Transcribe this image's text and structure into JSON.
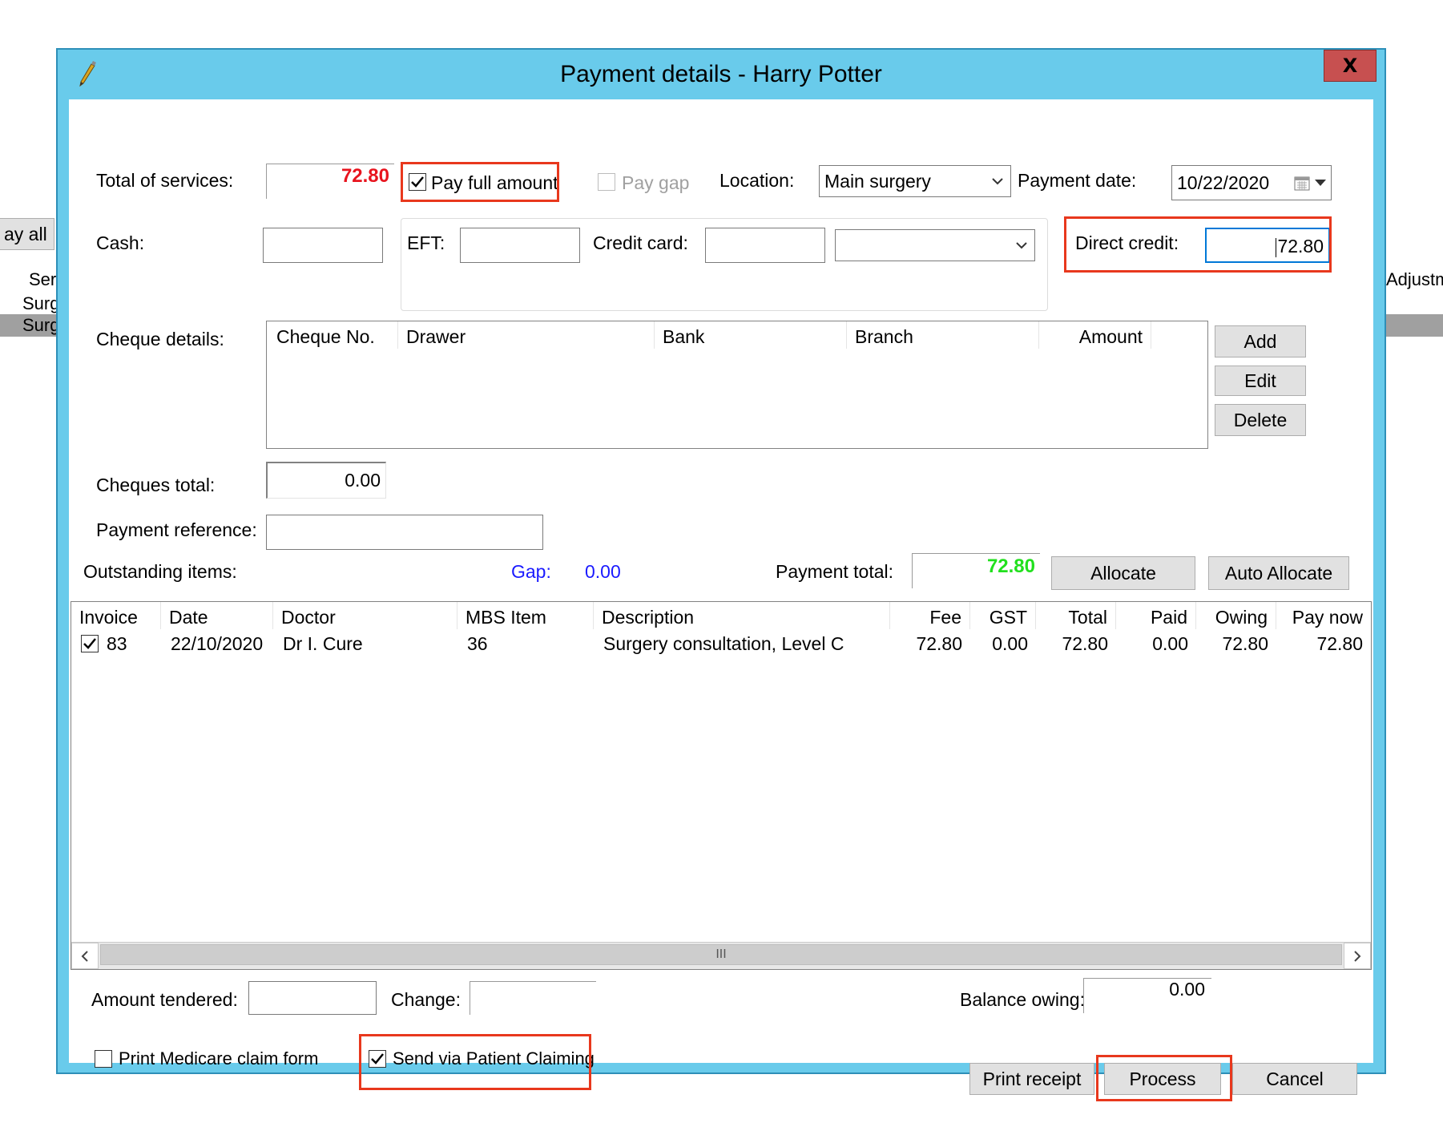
{
  "background": {
    "pay_all_label": "ay all",
    "col_ser": "Ser",
    "row1": "Surg",
    "row2": "Surg",
    "col_adjust": "Adjustm"
  },
  "dialog": {
    "title": "Payment details - Harry Potter",
    "close_label": "X"
  },
  "form": {
    "total_services_label": "Total of services:",
    "total_services_value": "72.80",
    "pay_full_amount_label": "Pay full amount",
    "pay_full_amount_checked": true,
    "pay_gap_label": "Pay gap",
    "location_label": "Location:",
    "location_value": "Main surgery",
    "payment_date_label": "Payment date:",
    "payment_date_value": "10/22/2020",
    "cash_label": "Cash:",
    "cash_value": "",
    "eft_label": "EFT:",
    "eft_value": "",
    "credit_card_label": "Credit card:",
    "credit_card_value": "",
    "credit_card_type": "",
    "direct_credit_label": "Direct credit:",
    "direct_credit_value": "72.80",
    "cheque_details_label": "Cheque details:",
    "cheques_total_label": "Cheques total:",
    "cheques_total_value": "0.00",
    "payment_reference_label": "Payment reference:",
    "payment_reference_value": "",
    "outstanding_items_label": "Outstanding items:",
    "gap_label": "Gap:",
    "gap_value": "0.00",
    "payment_total_label": "Payment total:",
    "payment_total_value": "72.80"
  },
  "cheque_grid": {
    "columns": [
      "Cheque No.",
      "Drawer",
      "Bank",
      "Branch",
      "Amount"
    ]
  },
  "cheque_buttons": {
    "add": "Add",
    "edit": "Edit",
    "delete": "Delete"
  },
  "allocate_buttons": {
    "allocate": "Allocate",
    "auto_allocate": "Auto Allocate"
  },
  "items_grid": {
    "columns": [
      "Invoice",
      "Date",
      "Doctor",
      "MBS Item",
      "Description",
      "Fee",
      "GST",
      "Total",
      "Paid",
      "Owing",
      "Pay now"
    ],
    "rows": [
      {
        "checked": true,
        "invoice": "83",
        "date": "22/10/2020",
        "doctor": "Dr I. Cure",
        "mbs_item": "36",
        "description": "Surgery consultation, Level C",
        "fee": "72.80",
        "gst": "0.00",
        "total": "72.80",
        "paid": "0.00",
        "owing": "72.80",
        "pay_now": "72.80"
      }
    ],
    "scroll_thumb_glyph": "III"
  },
  "footer": {
    "amount_tendered_label": "Amount tendered:",
    "amount_tendered_value": "",
    "change_label": "Change:",
    "change_value": "",
    "balance_owing_label": "Balance owing:",
    "balance_owing_value": "0.00",
    "print_medicare_label": "Print Medicare claim form",
    "print_medicare_checked": false,
    "send_patient_claiming_label": "Send via Patient Claiming",
    "send_patient_claiming_checked": true,
    "print_receipt": "Print receipt",
    "process": "Process",
    "cancel": "Cancel"
  },
  "colors": {
    "window_frame": "#69cbeb",
    "highlight": "#e8381d",
    "total_red": "#e8141e",
    "payment_total_green": "#22e01e",
    "gap_blue": "#1a1aff"
  }
}
